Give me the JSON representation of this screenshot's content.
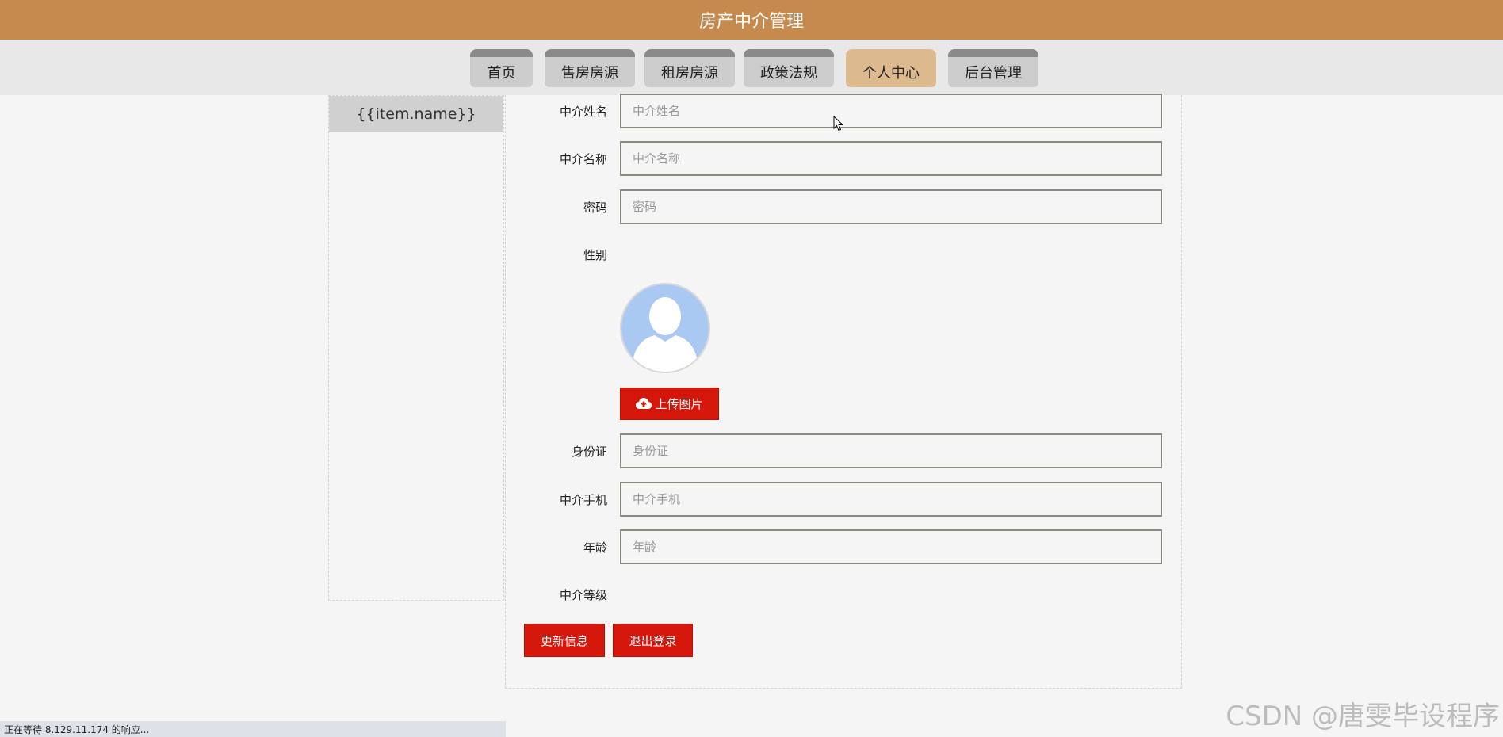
{
  "app": {
    "title": "房产中介管理"
  },
  "nav": {
    "items": [
      {
        "label": "首页"
      },
      {
        "label": "售房房源"
      },
      {
        "label": "租房房源"
      },
      {
        "label": "政策法规"
      },
      {
        "label": "个人中心",
        "active": true
      },
      {
        "label": "后台管理"
      }
    ]
  },
  "sidebar": {
    "items": [
      {
        "label": "{{item.name}}"
      }
    ]
  },
  "form": {
    "agent_name": {
      "label": "中介姓名",
      "placeholder": "中介姓名",
      "value": ""
    },
    "agency_name": {
      "label": "中介名称",
      "placeholder": "中介名称",
      "value": ""
    },
    "password": {
      "label": "密码",
      "placeholder": "密码",
      "value": ""
    },
    "gender": {
      "label": "性别"
    },
    "upload_button": {
      "label": "上传图片",
      "icon": "cloud-upload-icon"
    },
    "id_card": {
      "label": "身份证",
      "placeholder": "身份证",
      "value": ""
    },
    "phone": {
      "label": "中介手机",
      "placeholder": "中介手机",
      "value": ""
    },
    "age": {
      "label": "年龄",
      "placeholder": "年龄",
      "value": ""
    },
    "level": {
      "label": "中介等级"
    },
    "update_button": {
      "label": "更新信息"
    },
    "logout_button": {
      "label": "退出登录"
    }
  },
  "status": {
    "text": "正在等待 8.129.11.174 的响应..."
  },
  "watermark": {
    "text": "CSDN @唐雯毕设程序"
  },
  "colors": {
    "header": "#c68a4e",
    "nav_active": "#ddb98e",
    "button_red": "#d5170b",
    "avatar_silhouette": "#a9c8f2"
  }
}
